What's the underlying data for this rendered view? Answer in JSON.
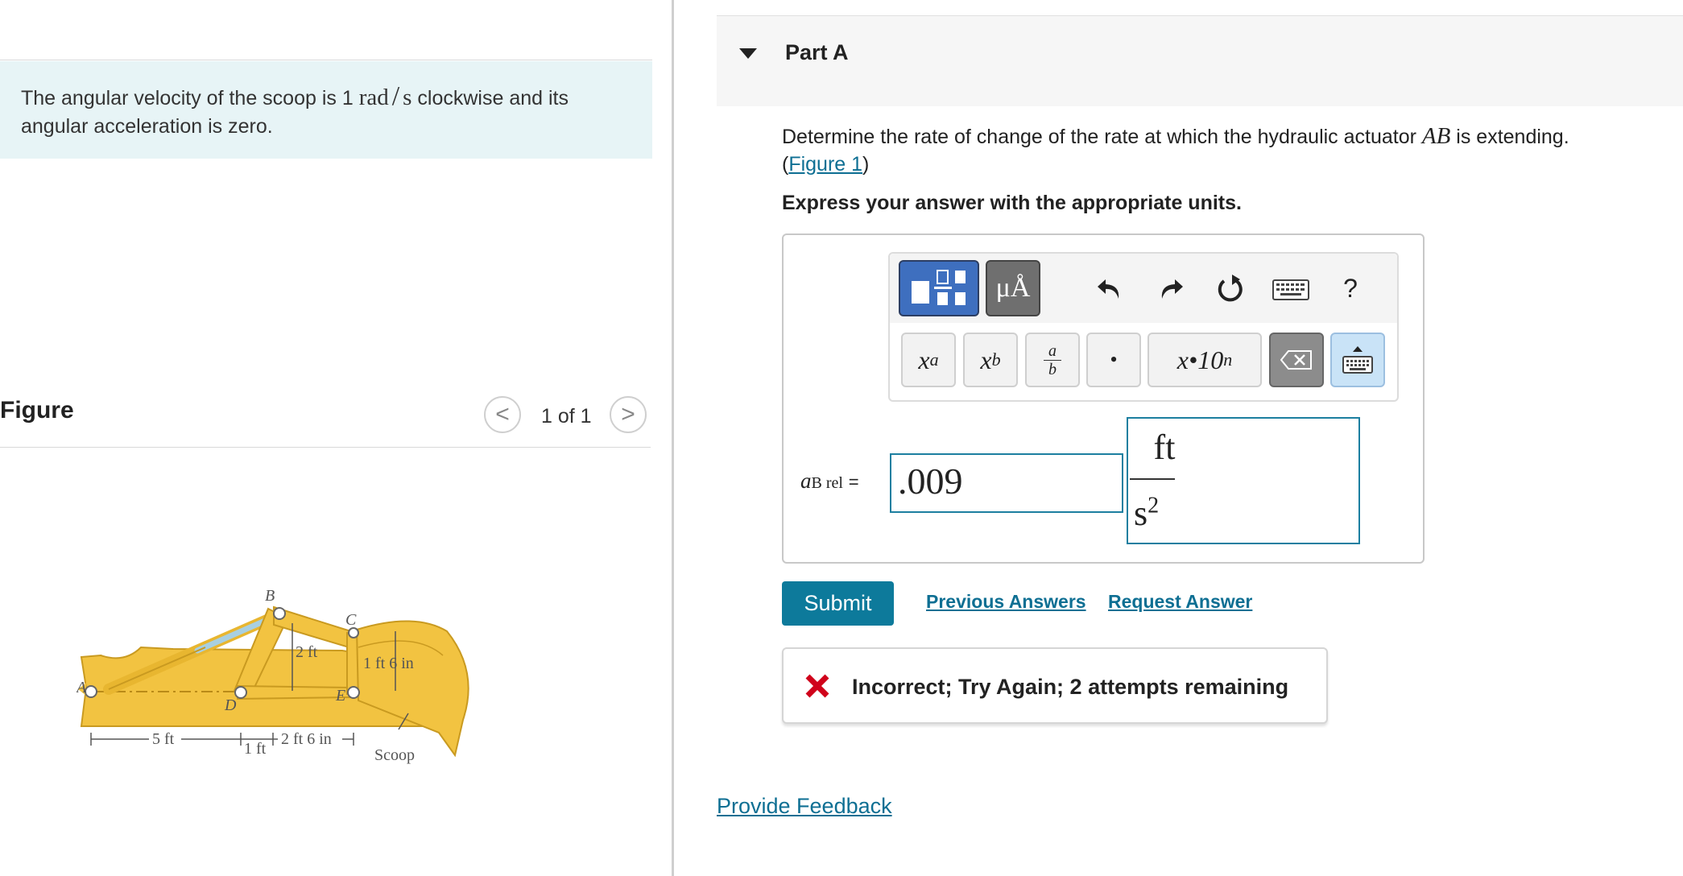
{
  "intro": {
    "text_before": "The angular velocity of the scoop is 1 ",
    "rad": "rad",
    "slash": "/",
    "s": "s",
    "text_after": " clockwise and its angular acceleration is zero."
  },
  "figure_panel": {
    "label": "Figure",
    "counter": "1 of 1",
    "prev": "<",
    "next": ">",
    "labels": {
      "a": "A",
      "b": "B",
      "c": "C",
      "d": "D",
      "e": "E",
      "dim_2ft": "2 ft",
      "dim_1ft6in": "1 ft 6 in",
      "dim_5ft": "5 ft",
      "dim_1ft": "1 ft",
      "dim_2ft6in": "2 ft 6 in",
      "scoop": "Scoop"
    }
  },
  "part": {
    "title": "Part A",
    "question_before": "Determine the rate of change of the rate at which the hydraulic actuator ",
    "question_var": "AB",
    "question_after": " is extending.",
    "link_open": "(",
    "figure_link": "Figure 1",
    "link_close": ")",
    "instruction": "Express your answer with the appropriate units."
  },
  "toolbar": {
    "units_label": "μÅ",
    "help_label": "?",
    "sup_base": "x",
    "sup_exp": "a",
    "sub_base": "x",
    "sub_idx": "b",
    "frac_num": "a",
    "frac_den": "b",
    "dot_label": "•",
    "sci_label": "x•10",
    "sci_exp": "n"
  },
  "answer": {
    "var": "a",
    "var_sub": "B rel",
    "equals": "=",
    "value": ".009",
    "unit_num": "ft",
    "unit_den": "s",
    "unit_den_exp": "2"
  },
  "actions": {
    "submit": "Submit",
    "previous_answers": "Previous Answers",
    "request_answer": "Request Answer"
  },
  "feedback": {
    "message": "Incorrect; Try Again; 2 attempts remaining",
    "error_color": "#d0021b"
  },
  "footer": {
    "provide_feedback": "Provide Feedback"
  },
  "colors": {
    "link": "#0e6f93",
    "submit_bg": "#0d7a9b",
    "intro_bg": "#e7f4f6",
    "template_btn": "#3e6fbf"
  }
}
